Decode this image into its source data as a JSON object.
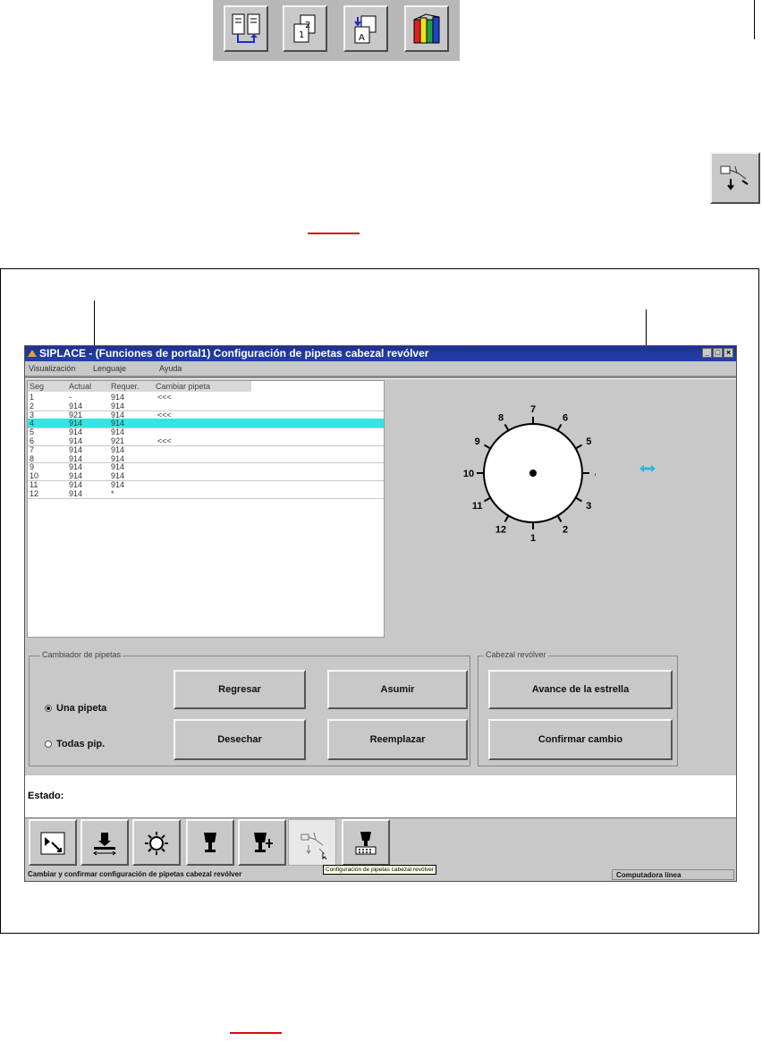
{
  "window": {
    "title": "SIPLACE - (Funciones de portal1) Configuración de pipetas cabezal revólver",
    "controls": [
      "_",
      "□",
      "×"
    ]
  },
  "menu": [
    "Visualización",
    "Lenguaje",
    "Ayuda"
  ],
  "table": {
    "headers": [
      "Seg",
      "Actual",
      "Requer.",
      "Cambiar pipeta"
    ],
    "rows": [
      {
        "seg": "1",
        "actual": "-",
        "requer": "914",
        "cambiar": "<<<"
      },
      {
        "seg": "2",
        "actual": "914",
        "requer": "914",
        "cambiar": ""
      },
      {
        "seg": "3",
        "actual": "921",
        "requer": "914",
        "cambiar": "<<<"
      },
      {
        "seg": "4",
        "actual": "914",
        "requer": "914",
        "cambiar": ""
      },
      {
        "seg": "5",
        "actual": "914",
        "requer": "914",
        "cambiar": ""
      },
      {
        "seg": "6",
        "actual": "914",
        "requer": "921",
        "cambiar": "<<<"
      },
      {
        "seg": "7",
        "actual": "914",
        "requer": "914",
        "cambiar": ""
      },
      {
        "seg": "8",
        "actual": "914",
        "requer": "914",
        "cambiar": ""
      },
      {
        "seg": "9",
        "actual": "914",
        "requer": "914",
        "cambiar": ""
      },
      {
        "seg": "10",
        "actual": "914",
        "requer": "914",
        "cambiar": ""
      },
      {
        "seg": "11",
        "actual": "914",
        "requer": "914",
        "cambiar": ""
      },
      {
        "seg": "12",
        "actual": "914",
        "requer": "*",
        "cambiar": ""
      }
    ],
    "selected_row": 4
  },
  "dial": {
    "labels": [
      "1",
      "2",
      "3",
      "4",
      "5",
      "6",
      "7",
      "8",
      "9",
      "10",
      "11",
      "12"
    ]
  },
  "cambiador": {
    "label": "Cambiador de pipetas",
    "radio_una": "Una pipeta",
    "radio_todas": "Todas pip.",
    "btn_regresar": "Regresar",
    "btn_asumir": "Asumir",
    "btn_desechar": "Desechar",
    "btn_reemplazar": "Reemplazar"
  },
  "cabezal": {
    "label": "Cabezal revólver",
    "btn_avance": "Avance de la estrella",
    "btn_confirmar": "Confirmar cambio"
  },
  "status": {
    "label": "Estado:",
    "bar_left": "Cambiar y confirmar configuración de pipetas cabezal revólver",
    "bar_right": "Computadora línea"
  },
  "tooltip": "Configuración de pipetas cabezal revólver",
  "bottom_toolbar_icons": [
    "select-arrow-icon",
    "conveyor-icon",
    "sun-icon",
    "nozzle-icon",
    "nozzle-plus-icon",
    "nozzle-config-icon",
    "nozzle-tray-icon"
  ],
  "colors": {
    "titlebar": "#1c2f96",
    "selection": "#35e5e5",
    "accent_red": "#d01010"
  }
}
